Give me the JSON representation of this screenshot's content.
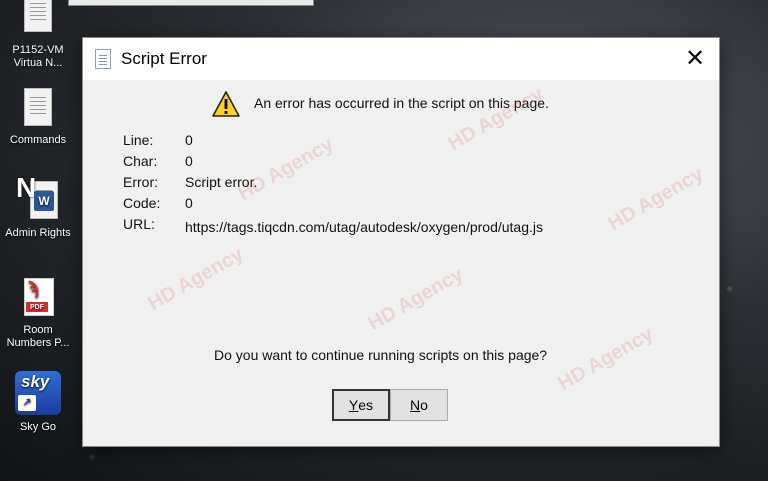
{
  "desktop": {
    "icons": [
      {
        "label": "P1152-VM\nVirtua N..."
      },
      {
        "label": "Commands"
      },
      {
        "label": "Admin Rights"
      },
      {
        "label": "Room\nNumbers P..."
      },
      {
        "label": "Sky Go"
      }
    ],
    "pdf_badge": "PDF",
    "word_badge": "W",
    "sky_brand": "sky"
  },
  "dialog": {
    "title": "Script Error",
    "close_glyph": "✕",
    "message": "An error has occurred in the script on this page.",
    "details": [
      {
        "label": "Line:",
        "value": "0"
      },
      {
        "label": "Char:",
        "value": "0"
      },
      {
        "label": "Error:",
        "value": "Script error."
      },
      {
        "label": "Code:",
        "value": "0"
      },
      {
        "label": "URL:",
        "value": "https://tags.tiqcdn.com/utag/autodesk/oxygen/prod/utag.js"
      }
    ],
    "question": "Do you want to continue running scripts on this page?",
    "buttons": {
      "yes_mnemonic": "Y",
      "yes_rest": "es",
      "no_mnemonic": "N",
      "no_rest": "o"
    }
  },
  "watermark": "HD Agency",
  "colors": {
    "dialog_bg": "#f0f0f0",
    "titlebar_bg": "#ffffff",
    "warning_yellow": "#ffd21a",
    "word_blue": "#2b579a",
    "pdf_red": "#d32f2f",
    "sky_blue": "#2f6fd8"
  }
}
